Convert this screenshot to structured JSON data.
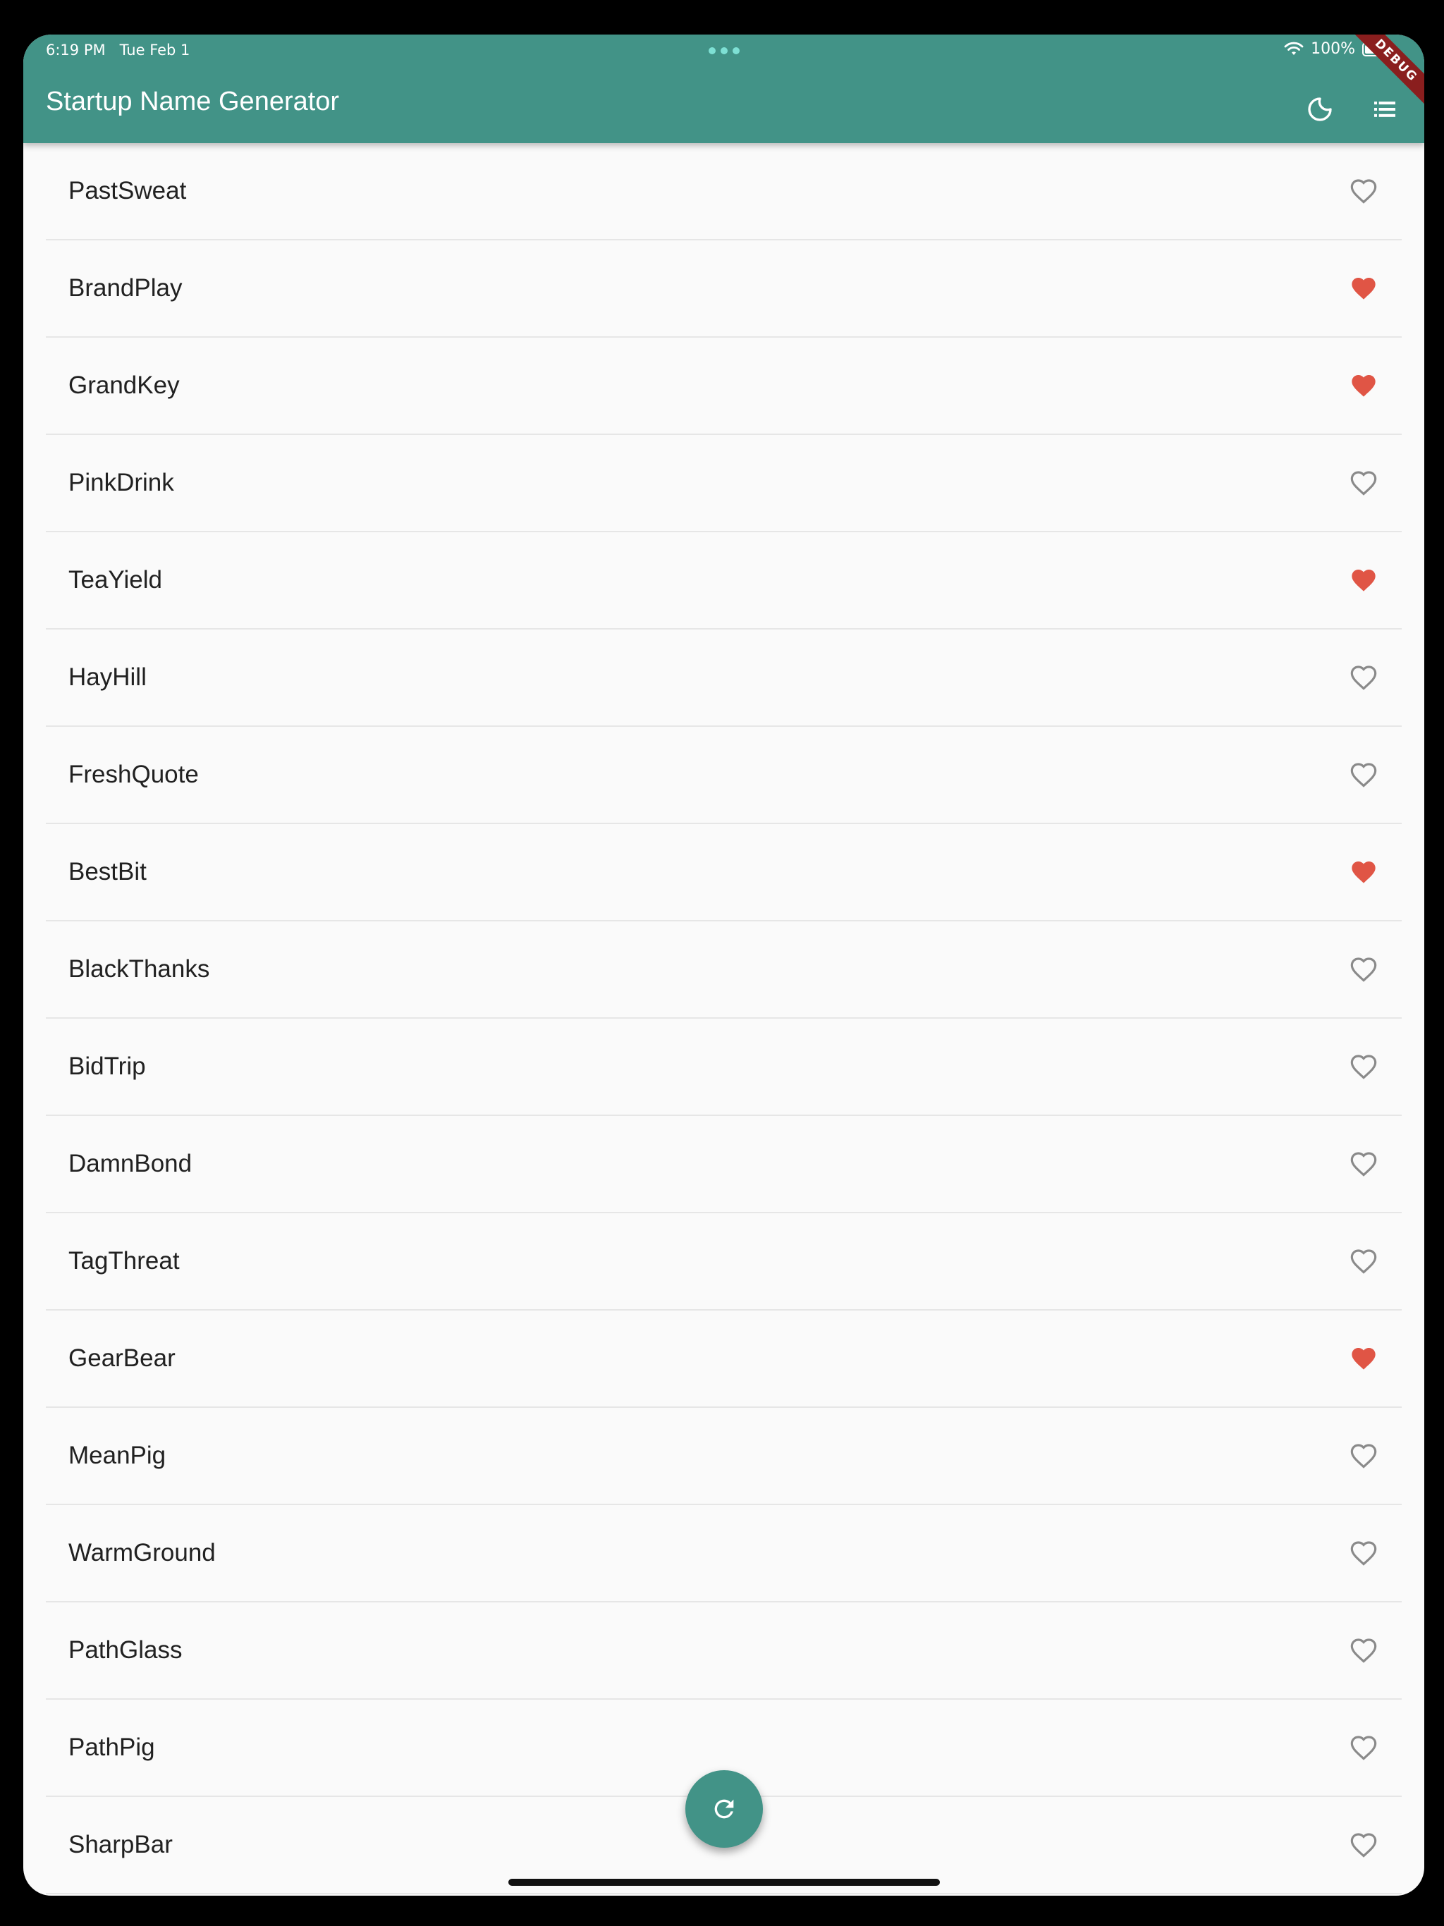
{
  "status_bar": {
    "time": "6:19 PM",
    "date": "Tue Feb 1",
    "battery": "100%"
  },
  "debug_label": "DEBUG",
  "app_bar": {
    "title": "Startup Name Generator",
    "actions": [
      {
        "icon": "moon-icon"
      },
      {
        "icon": "list-icon"
      }
    ]
  },
  "colors": {
    "primary": "#429387",
    "favorite": "#e05545",
    "not_favorite": "#8a8a8a"
  },
  "items": [
    {
      "name": "PastSweat",
      "favorite": false
    },
    {
      "name": "BrandPlay",
      "favorite": true
    },
    {
      "name": "GrandKey",
      "favorite": true
    },
    {
      "name": "PinkDrink",
      "favorite": false
    },
    {
      "name": "TeaYield",
      "favorite": true
    },
    {
      "name": "HayHill",
      "favorite": false
    },
    {
      "name": "FreshQuote",
      "favorite": false
    },
    {
      "name": "BestBit",
      "favorite": true
    },
    {
      "name": "BlackThanks",
      "favorite": false
    },
    {
      "name": "BidTrip",
      "favorite": false
    },
    {
      "name": "DamnBond",
      "favorite": false
    },
    {
      "name": "TagThreat",
      "favorite": false
    },
    {
      "name": "GearBear",
      "favorite": true
    },
    {
      "name": "MeanPig",
      "favorite": false
    },
    {
      "name": "WarmGround",
      "favorite": false
    },
    {
      "name": "PathGlass",
      "favorite": false
    },
    {
      "name": "PathPig",
      "favorite": false
    },
    {
      "name": "SharpBar",
      "favorite": false
    }
  ],
  "fab": {
    "icon": "refresh-icon"
  }
}
